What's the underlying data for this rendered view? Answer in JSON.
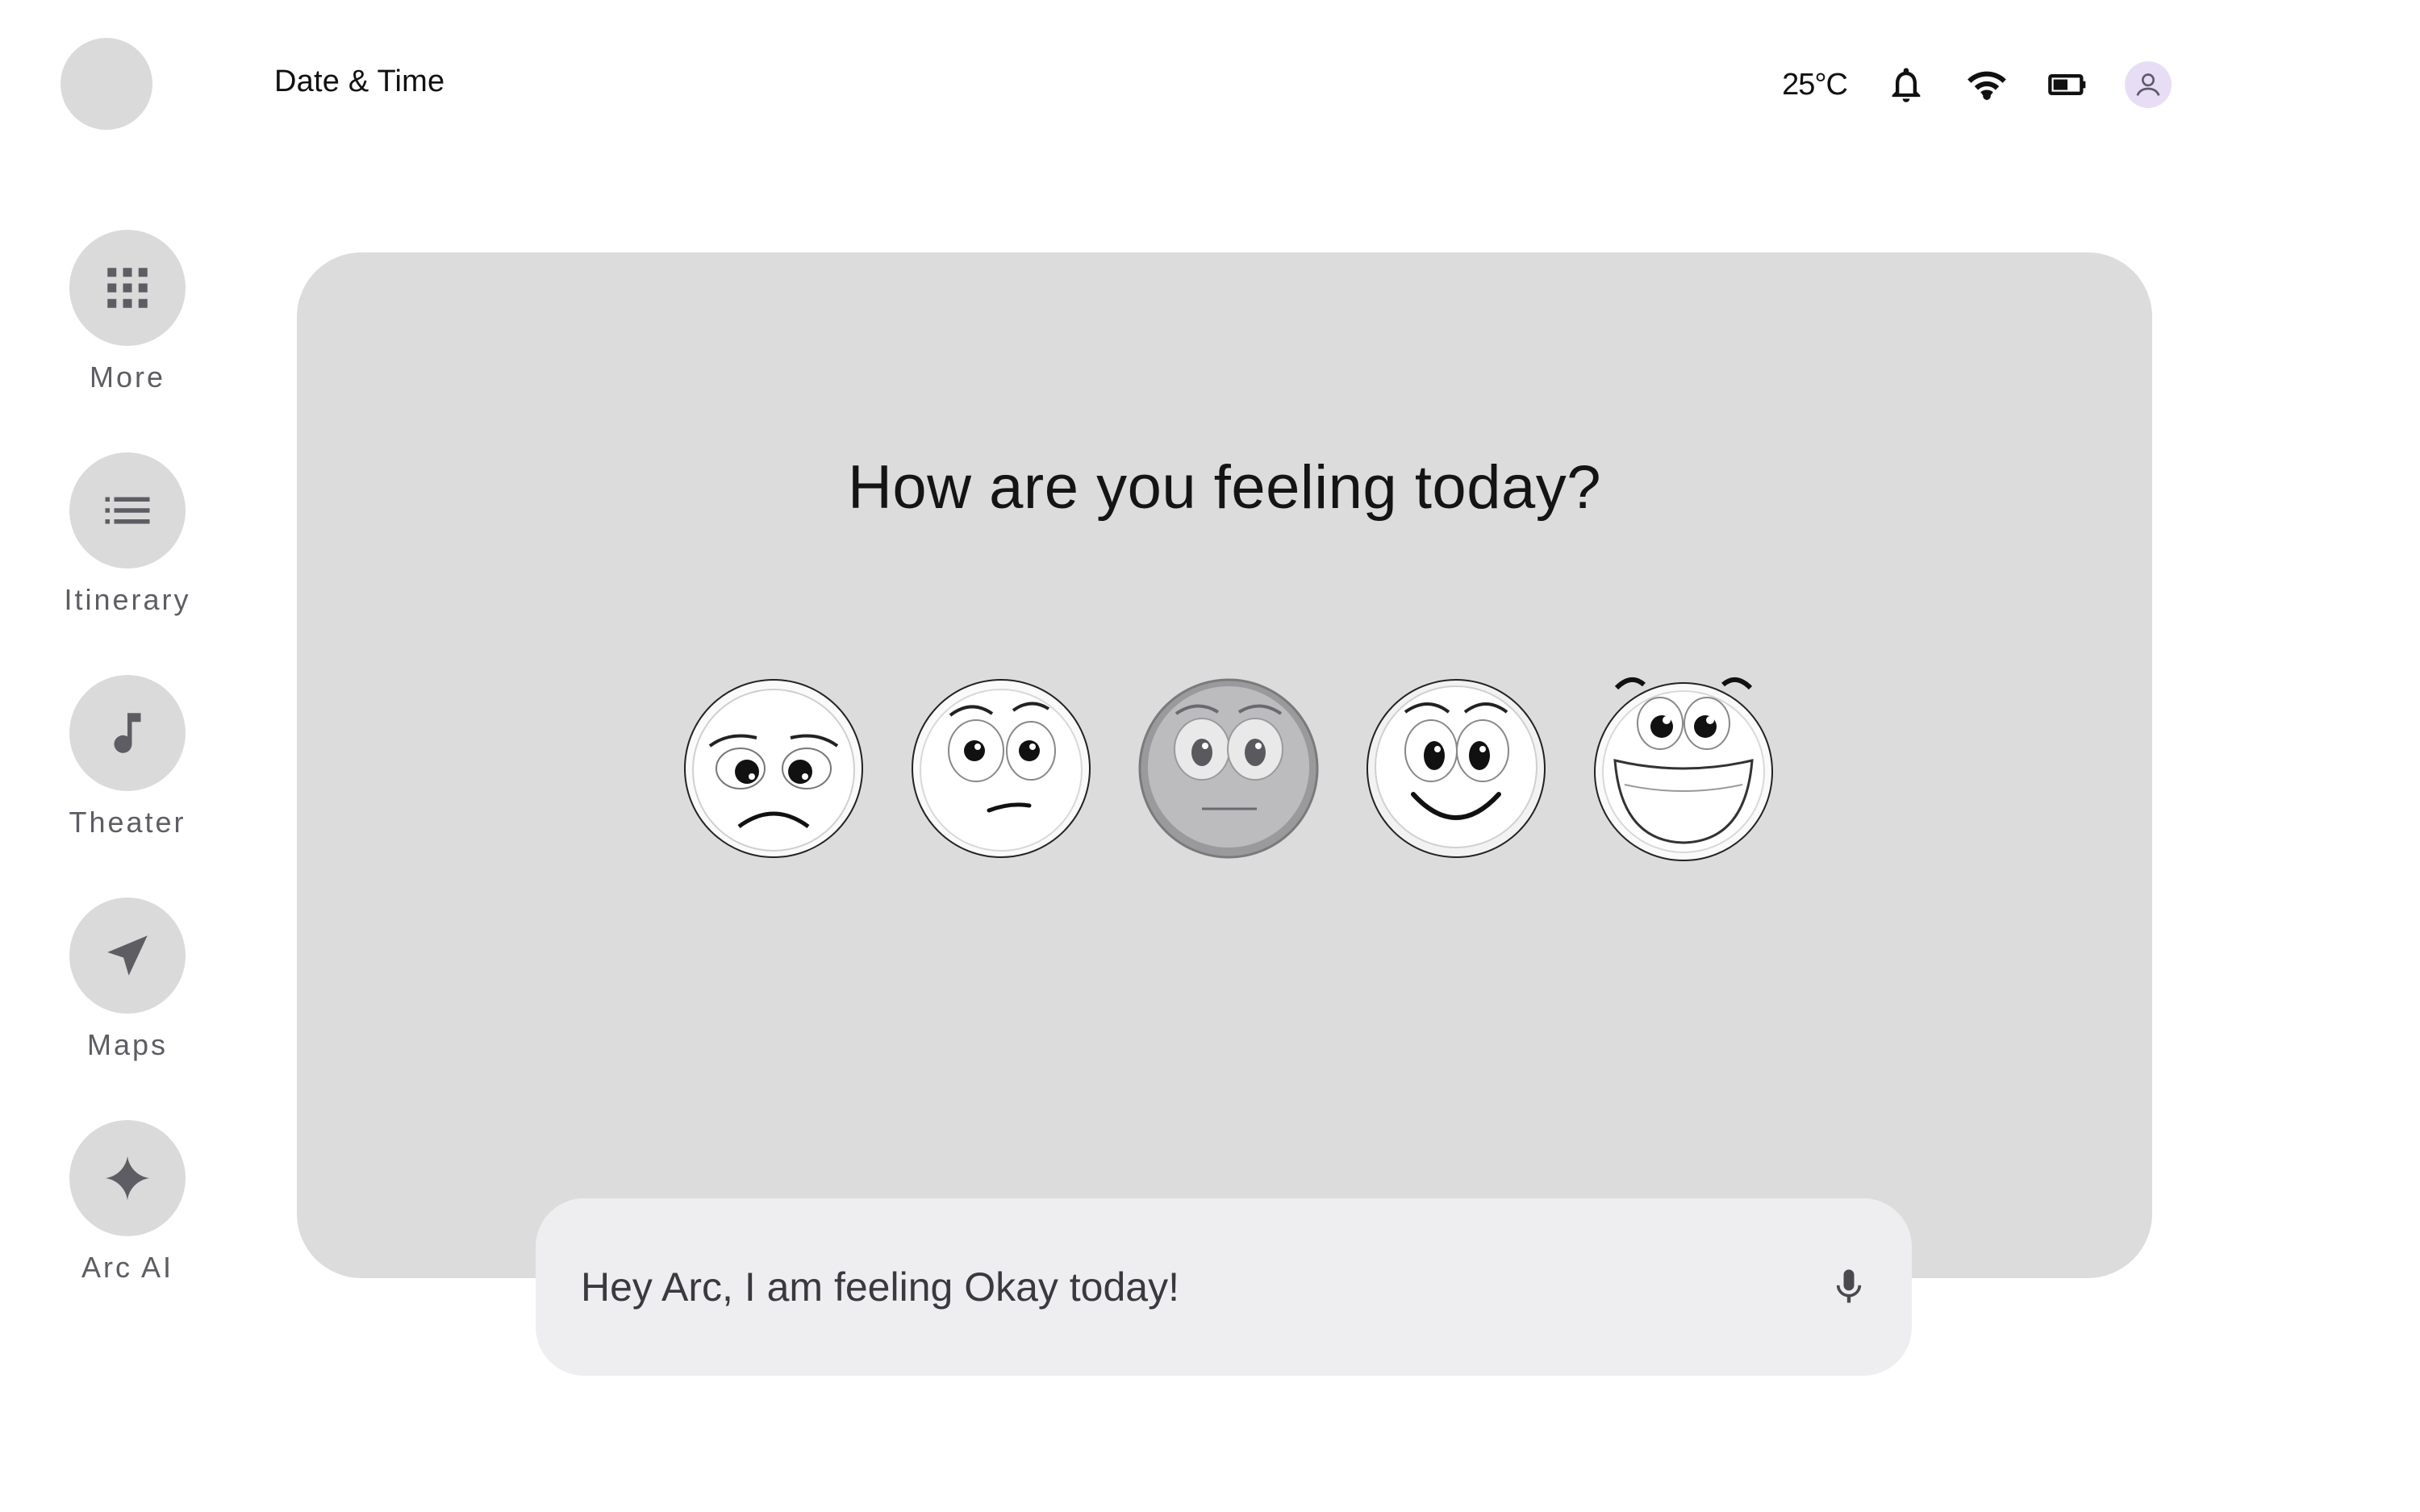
{
  "header": {
    "date_time_label": "Date & Time",
    "temperature": "25°C",
    "icons": [
      "bell-icon",
      "wifi-icon",
      "battery-icon",
      "user-avatar-icon"
    ]
  },
  "sidebar": {
    "items": [
      {
        "label": "More",
        "icon": "apps-grid-icon"
      },
      {
        "label": "Itinerary",
        "icon": "list-icon"
      },
      {
        "label": "Theater",
        "icon": "music-note-icon"
      },
      {
        "label": "Maps",
        "icon": "navigation-arrow-icon"
      },
      {
        "label": "Arc AI",
        "icon": "sparkle-icon"
      }
    ]
  },
  "main": {
    "question": "How are you feeling today?",
    "moods": [
      {
        "name": "sad",
        "selected": false
      },
      {
        "name": "unsure",
        "selected": false
      },
      {
        "name": "okay",
        "selected": true
      },
      {
        "name": "happy",
        "selected": false
      },
      {
        "name": "excited",
        "selected": false
      }
    ]
  },
  "input": {
    "text": "Hey Arc, I am feeling Okay today!",
    "icon": "microphone-icon"
  },
  "colors": {
    "card_bg": "#dcdcdc",
    "sidebar_btn_bg": "#dadada",
    "input_bg": "#eeeef0",
    "avatar_bg": "#e7def6",
    "selected_mood_fill": "#b9b9bb"
  }
}
